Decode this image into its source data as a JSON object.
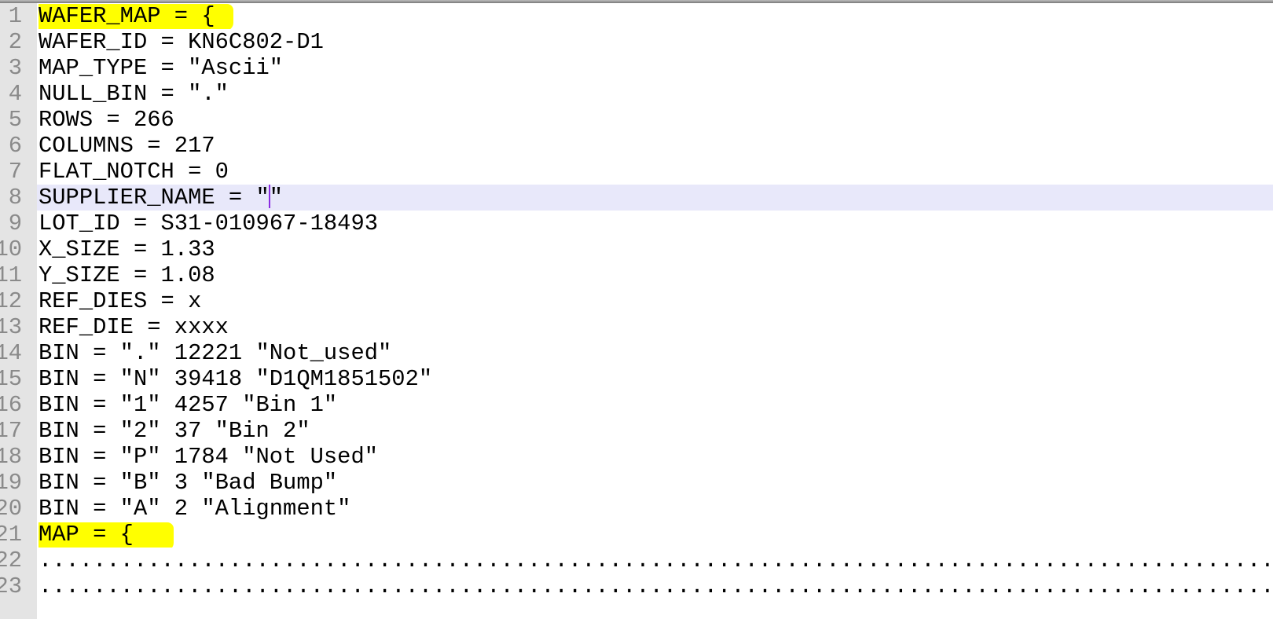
{
  "editor": {
    "current_line": 8,
    "caret_line": 8,
    "caret_after": "SUPPLIER_NAME = \"",
    "highlight_color": "#ffff00",
    "current_line_color": "#e8e8fa",
    "lines": [
      {
        "n": "1",
        "text": "WAFER_MAP = {"
      },
      {
        "n": "2",
        "text": "WAFER_ID = KN6C802-D1"
      },
      {
        "n": "3",
        "text": "MAP_TYPE = \"Ascii\""
      },
      {
        "n": "4",
        "text": "NULL_BIN = \".\""
      },
      {
        "n": "5",
        "text": "ROWS = 266"
      },
      {
        "n": "6",
        "text": "COLUMNS = 217"
      },
      {
        "n": "7",
        "text": "FLAT_NOTCH = 0"
      },
      {
        "n": "8",
        "text_before_caret": "SUPPLIER_NAME = \"",
        "text_after_caret": "\""
      },
      {
        "n": "9",
        "text": "LOT_ID = S31-010967-18493"
      },
      {
        "n": "10",
        "text": "X_SIZE = 1.33"
      },
      {
        "n": "11",
        "text": "Y_SIZE = 1.08"
      },
      {
        "n": "12",
        "text": "REF_DIES = x"
      },
      {
        "n": "13",
        "text": "REF_DIE = xxxx"
      },
      {
        "n": "14",
        "text": "BIN = \".\" 12221 \"Not_used\""
      },
      {
        "n": "15",
        "text": "BIN = \"N\" 39418 \"D1QM1851502\""
      },
      {
        "n": "16",
        "text": "BIN = \"1\" 4257 \"Bin 1\""
      },
      {
        "n": "17",
        "text": "BIN = \"2\" 37 \"Bin 2\""
      },
      {
        "n": "18",
        "text": "BIN = \"P\" 1784 \"Not Used\""
      },
      {
        "n": "19",
        "text": "BIN = \"B\" 3 \"Bad Bump\""
      },
      {
        "n": "20",
        "text": "BIN = \"A\" 2 \"Alignment\""
      },
      {
        "n": "21",
        "text": "MAP = {"
      },
      {
        "n": "22",
        "text": "......................................................................................................"
      },
      {
        "n": "23",
        "text": "......................................................................................................"
      }
    ]
  }
}
